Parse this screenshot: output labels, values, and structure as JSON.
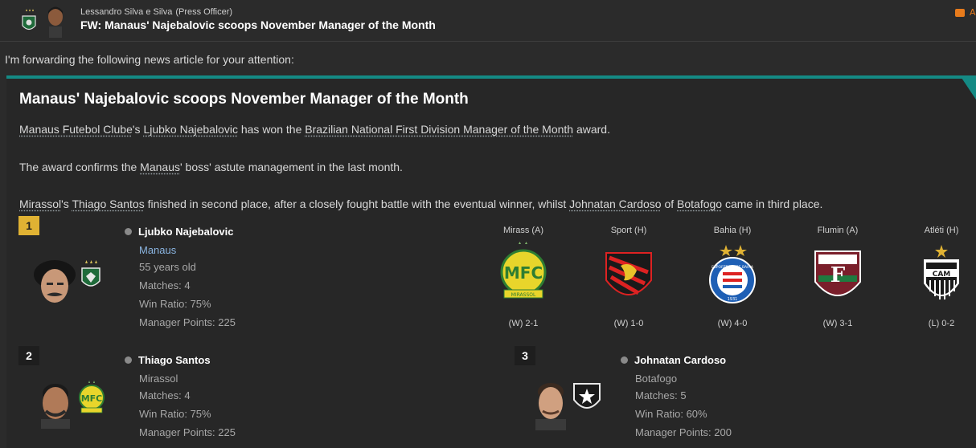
{
  "header": {
    "sender_name": "Lessandro Silva e Silva",
    "sender_role": "(Press Officer)",
    "subject": "FW: Manaus' Najebalovic scoops November Manager of the Month"
  },
  "intro": "I'm forwarding the following news article for your attention:",
  "article": {
    "title": "Manaus' Najebalovic scoops November Manager of the Month",
    "p1": {
      "club": "Manaus Futebol Clube",
      "s1": "'s ",
      "manager": "Ljubko Najebalovic",
      "s2": " has won the ",
      "award": "Brazilian National First Division Manager of the Month",
      "s3": " award."
    },
    "p2": {
      "s1": "The award confirms the ",
      "club": "Manaus",
      "s2": "' boss' astute management in the last month."
    },
    "p3": {
      "club1": "Mirassol",
      "s1": "'s ",
      "mgr2": "Thiago Santos",
      "s2": " finished in second place, after a closely fought battle with the eventual winner, whilst ",
      "mgr3": "Johnatan Cardoso",
      "s3": " of ",
      "club3": "Botafogo",
      "s4": " came in third place."
    }
  },
  "winners": [
    {
      "rank": "1",
      "name": "Ljubko Najebalovic",
      "club": "Manaus",
      "age": "55 years old",
      "matches": "Matches: 4",
      "win_ratio": "Win Ratio: 75%",
      "points": "Manager Points: 225"
    },
    {
      "rank": "2",
      "name": "Thiago Santos",
      "club": "Mirassol",
      "matches": "Matches: 4",
      "win_ratio": "Win Ratio: 75%",
      "points": "Manager Points: 225"
    },
    {
      "rank": "3",
      "name": "Johnatan Cardoso",
      "club": "Botafogo",
      "matches": "Matches: 5",
      "win_ratio": "Win Ratio: 60%",
      "points": "Manager Points: 200"
    }
  ],
  "matches": [
    {
      "opponent": "Mirass (A)",
      "result": "(W) 2-1",
      "badge": "mirassol-badge"
    },
    {
      "opponent": "Sport (H)",
      "result": "(W) 1-0",
      "badge": "sport-badge"
    },
    {
      "opponent": "Bahia (H)",
      "result": "(W) 4-0",
      "badge": "bahia-badge"
    },
    {
      "opponent": "Flumin (A)",
      "result": "(W) 3-1",
      "badge": "fluminense-badge"
    },
    {
      "opponent": "Atléti (H)",
      "result": "(L) 0-2",
      "badge": "atletico-mg-badge"
    }
  ],
  "badge_lettering": {
    "mirassol": "MFC",
    "mirassol_ribbon": "MIRASSOL",
    "bahia": "ESPORTE CLUBE BAHIA",
    "bahia_year": "1931",
    "atletico": "CAM"
  },
  "colors": {
    "accent_teal": "#148a84",
    "rank_gold": "#e0b233",
    "link_blue": "#8ab4e0",
    "flag_orange": "#e77b1c"
  }
}
